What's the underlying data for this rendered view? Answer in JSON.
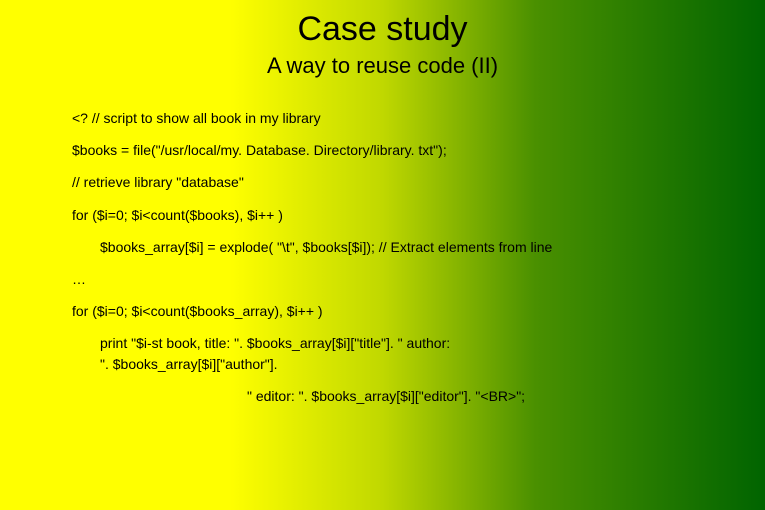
{
  "title": "Case study",
  "subtitle": "A way to reuse code (II)",
  "code": {
    "line1": "<? // script to show all book in my library",
    "line2": "$books = file(\"/usr/local/my. Database. Directory/library. txt\");",
    "line3": "// retrieve library \"database\"",
    "line4": "for ($i=0; $i<count($books), $i++ )",
    "line5": "$books_array[$i] = explode( \"\\t\", $books[$i]); // Extract elements from line",
    "line6": "…",
    "line7": "for ($i=0; $i<count($books_array), $i++ )",
    "line8a": "print \"$i-st book, title: \". $books_array[$i][\"title\"]. \" author:",
    "line8b": "\". $books_array[$i][\"author\"].",
    "line9": "\" editor: \". $books_array[$i][\"editor\"]. \"<BR>\";"
  }
}
